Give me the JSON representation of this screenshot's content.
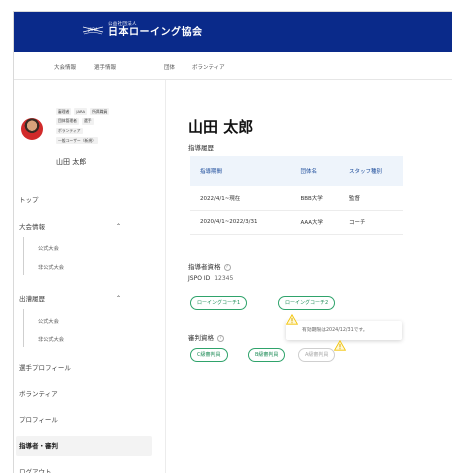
{
  "brand": {
    "sub": "公益社団法人",
    "name": "日本ローイング協会",
    "mark_text": "JARA"
  },
  "subnav": [
    "大会情報",
    "選手情報",
    "団体",
    "ボランティア"
  ],
  "profile": {
    "tags_row1": [
      "審理者",
      "JARA",
      "所属職員"
    ],
    "tags_row2": [
      "団体管理者",
      "選手"
    ],
    "tags_row3": [
      "ボランティア"
    ],
    "tags_row4": [
      "一般ユーザー（新規）"
    ],
    "name": "山田 太郎"
  },
  "sidebar": {
    "top": "トップ",
    "tournament": "大会情報",
    "tournament_subs": [
      "公式大会",
      "非公式大会"
    ],
    "entry": "出漕履歴",
    "entry_subs": [
      "公式大会",
      "非公式大会"
    ],
    "athlete_profile": "選手プロフィール",
    "volunteer": "ボランティア",
    "profile": "プロフィール",
    "coach_referee": "指導者・審判",
    "logout": "ログアウト"
  },
  "main": {
    "name": "山田 太郎",
    "history_label": "指導履歴",
    "table_headers": [
      "指導期間",
      "団体名",
      "スタッフ種別"
    ],
    "table_rows": [
      [
        "2022/4/1~現在",
        "BBB大学",
        "監督"
      ],
      [
        "2020/4/1~2022/3/31",
        "AAA大学",
        "コーチ"
      ]
    ],
    "coach_qual_label": "指導者資格",
    "jspo_label": "JSPO ID",
    "jspo_id": "12345",
    "coach_pills": [
      "ローイングコーチ1",
      "ローイングコーチ2"
    ],
    "tooltip": "有効期限は2024/12/31です。",
    "referee_label": "審判資格",
    "referee_pills": [
      "C級審判員",
      "B級審判員",
      "A級審判員"
    ],
    "info_glyph": "?"
  },
  "colors": {
    "header": "#0a2a8a",
    "accent_green": "#2fa36b",
    "warning": "#f2c200",
    "table_header_bg": "#eef4fb"
  }
}
